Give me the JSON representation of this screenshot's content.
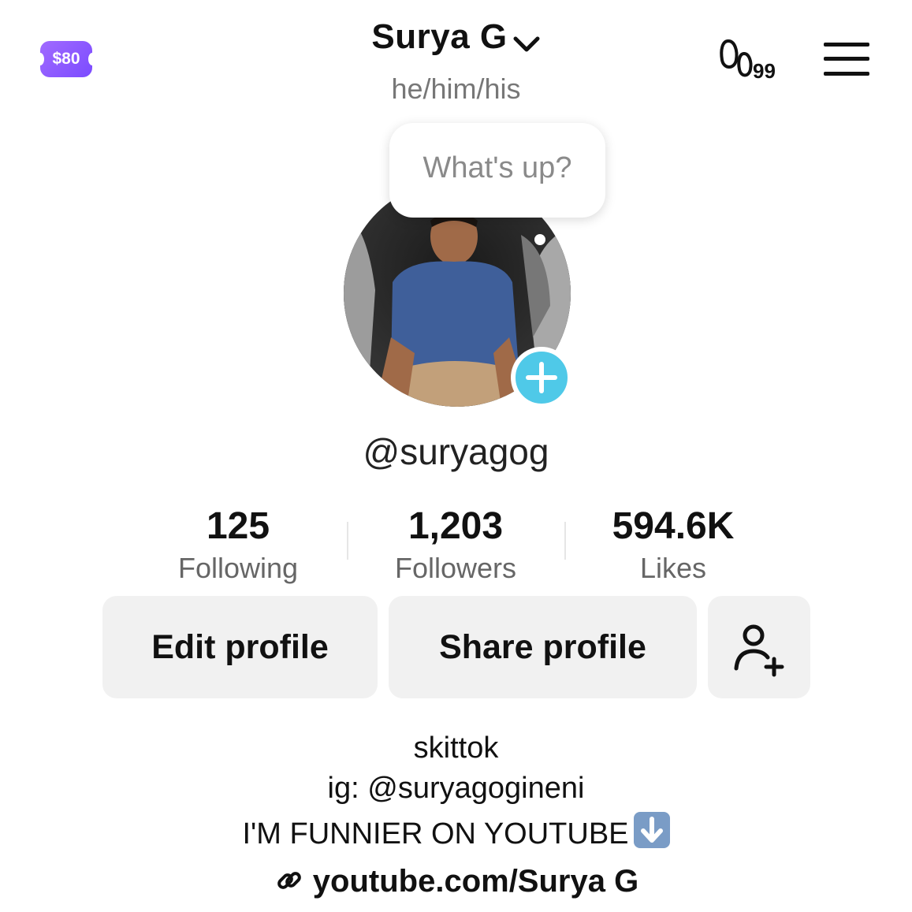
{
  "header": {
    "coin_label": "$80",
    "username_title": "Surya G",
    "pronouns": "he/him/his",
    "footprint_count": "99"
  },
  "avatar": {
    "bubble_text": "What's up?"
  },
  "profile": {
    "handle": "@suryagog"
  },
  "stats": [
    {
      "value": "125",
      "label": "Following"
    },
    {
      "value": "1,203",
      "label": "Followers"
    },
    {
      "value": "594.6K",
      "label": "Likes"
    }
  ],
  "actions": {
    "edit_label": "Edit profile",
    "share_label": "Share profile"
  },
  "bio": {
    "line1": "skittok",
    "line2": "ig: @suryagogineni",
    "line3": "I'M FUNNIER ON YOUTUBE",
    "link": "youtube.com/Surya G"
  },
  "colors": {
    "coin_purple": "#8a5cff",
    "add_button_blue": "#4fc9e8",
    "button_gray": "#f1f1f1"
  },
  "icons": [
    "coin-icon",
    "chevron-down-icon",
    "footprints-icon",
    "menu-icon",
    "plus-icon",
    "add-friend-icon",
    "down-arrow-emoji",
    "link-icon"
  ]
}
